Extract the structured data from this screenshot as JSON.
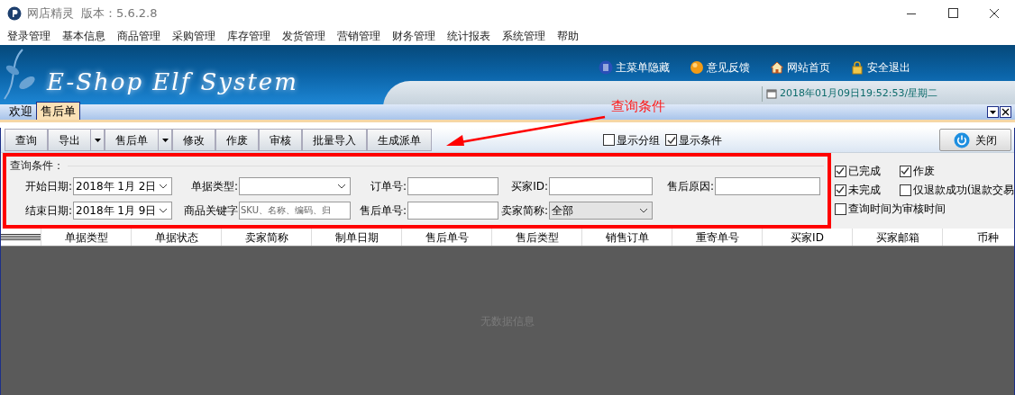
{
  "window": {
    "title": "网店精灵",
    "version": "版本：5.6.2.8"
  },
  "menu": [
    "登录管理",
    "基本信息",
    "商品管理",
    "采购管理",
    "库存管理",
    "发货管理",
    "营销管理",
    "财务管理",
    "统计报表",
    "系统管理",
    "帮助"
  ],
  "banner": {
    "logo_text": "E-Shop Elf System",
    "links": [
      {
        "label": "主菜单隐藏",
        "kind": "menu"
      },
      {
        "label": "意见反馈",
        "kind": "ball"
      },
      {
        "label": "网站首页",
        "kind": "home"
      },
      {
        "label": "安全退出",
        "kind": "lock"
      }
    ],
    "datetime": "2018年01月09日19:52:53/星期二"
  },
  "tabs": [
    {
      "label": "欢迎",
      "selected": false
    },
    {
      "label": "售后单",
      "selected": true
    }
  ],
  "annotation": {
    "label": "查询条件"
  },
  "toolbar": {
    "buttons": [
      {
        "label": "查询",
        "dropdown": false
      },
      {
        "label": "导出",
        "dropdown": true
      },
      {
        "label": "售后单",
        "dropdown": true
      },
      {
        "label": "修改",
        "dropdown": false
      },
      {
        "label": "作废",
        "dropdown": false
      },
      {
        "label": "审核",
        "dropdown": false
      },
      {
        "label": "批量导入",
        "dropdown": false
      },
      {
        "label": "生成派单",
        "dropdown": false
      }
    ],
    "toggles": [
      {
        "label": "显示分组",
        "checked": false
      },
      {
        "label": "显示条件",
        "checked": true
      }
    ],
    "close": "关闭"
  },
  "query": {
    "title": "查询条件：",
    "rows": [
      [
        {
          "label": "开始日期:",
          "kind": "date",
          "value": "2018年 1月 2日"
        },
        {
          "label": "单据类型:",
          "kind": "select"
        },
        {
          "label": "订单号:",
          "kind": "text"
        },
        {
          "label": "买家ID:",
          "kind": "text"
        },
        {
          "label": "售后原因:",
          "kind": "text"
        }
      ],
      [
        {
          "label": "结束日期:",
          "kind": "date",
          "value": "2018年 1月 9日"
        },
        {
          "label": "商品关键字",
          "kind": "text",
          "placeholder": "SKU、名称、编码、归"
        },
        {
          "label": "售后单号:",
          "kind": "text"
        },
        {
          "label": "卖家简称:",
          "kind": "select",
          "value": "全部"
        }
      ]
    ]
  },
  "filters": [
    {
      "label": "已完成",
      "checked": true
    },
    {
      "label": "作废",
      "checked": true
    },
    {
      "label": "未完成",
      "checked": true
    },
    {
      "label": "仅退款成功(退款交易",
      "checked": false
    },
    {
      "label": "查询时间为审核时间",
      "checked": false
    }
  ],
  "table": {
    "columns": [
      "单据类型",
      "单据状态",
      "卖家简称",
      "制单日期",
      "售后单号",
      "售后类型",
      "销售订单",
      "重寄单号",
      "买家ID",
      "买家邮箱",
      "币种"
    ],
    "empty_text": "无数据信息"
  }
}
